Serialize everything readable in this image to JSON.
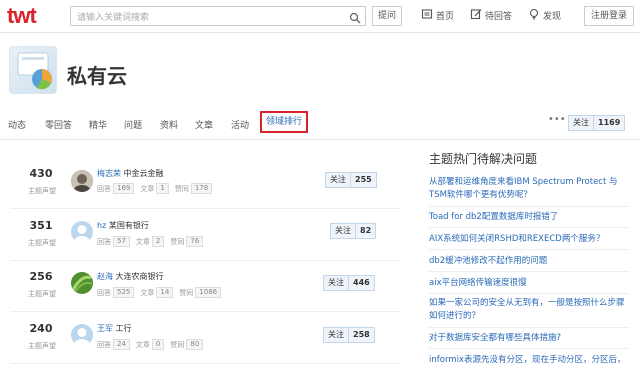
{
  "header": {
    "logo": "twt",
    "search_placeholder": "请输入关键词搜索",
    "ask_label": "提问",
    "nav": [
      {
        "label": "首页",
        "icon": "home-icon"
      },
      {
        "label": "待回答",
        "icon": "edit-icon"
      },
      {
        "label": "发现",
        "icon": "bulb-icon"
      }
    ],
    "register_label": "注册登录"
  },
  "topic": {
    "title": "私有云"
  },
  "tabs": [
    "动态",
    "零回答",
    "精华",
    "问题",
    "资料",
    "文章",
    "活动"
  ],
  "active_tab": "领域排行",
  "more_label": "•••",
  "topic_follow": {
    "label": "关注",
    "count": "1169"
  },
  "ranking": [
    {
      "score": "430",
      "rank_label": "主题声望",
      "name": "梅志荣",
      "org": "中金云金融",
      "answers_label": "回答",
      "answers": "169",
      "articles_label": "文章",
      "articles": "1",
      "likes_label": "赞同",
      "likes": "178",
      "follow_label": "关注",
      "follow_count": "255"
    },
    {
      "score": "351",
      "rank_label": "主题声望",
      "name": "hz",
      "org": "某国有银行",
      "answers_label": "回答",
      "answers": "57",
      "articles_label": "文章",
      "articles": "2",
      "likes_label": "赞同",
      "likes": "76",
      "follow_label": "关注",
      "follow_count": "82"
    },
    {
      "score": "256",
      "rank_label": "主题声望",
      "name": "赵海",
      "org": "大连农商银行",
      "answers_label": "回答",
      "answers": "525",
      "articles_label": "文章",
      "articles": "14",
      "likes_label": "赞同",
      "likes": "1086",
      "follow_label": "关注",
      "follow_count": "446"
    },
    {
      "score": "240",
      "rank_label": "主题声望",
      "name": "王军",
      "org": "工行",
      "answers_label": "回答",
      "answers": "24",
      "articles_label": "文章",
      "articles": "0",
      "likes_label": "赞同",
      "likes": "80",
      "follow_label": "关注",
      "follow_count": "258"
    }
  ],
  "sidebar": {
    "title": "主题热门待解决问题",
    "questions": [
      "从部署和运维角度来看IBM Spectrum Protect 与 TSM软件哪个更有优势呢？",
      "Toad for db2配置数据库时报错了",
      "AIX系统如何关闭RSHD和REXECD两个服务？",
      "db2缓冲池修改不起作用的问题",
      "aix平台网络传输速度很慢",
      "如果一家公司的安全从无到有，一般是按照什么步骤如何进行的？",
      "对于数据库安全都有哪些具体措施?",
      "informix表源先没有分区，现在手动分区，分区后，"
    ]
  },
  "colors": {
    "brand_red": "#d9232d",
    "link_blue": "#2a6ab8"
  }
}
